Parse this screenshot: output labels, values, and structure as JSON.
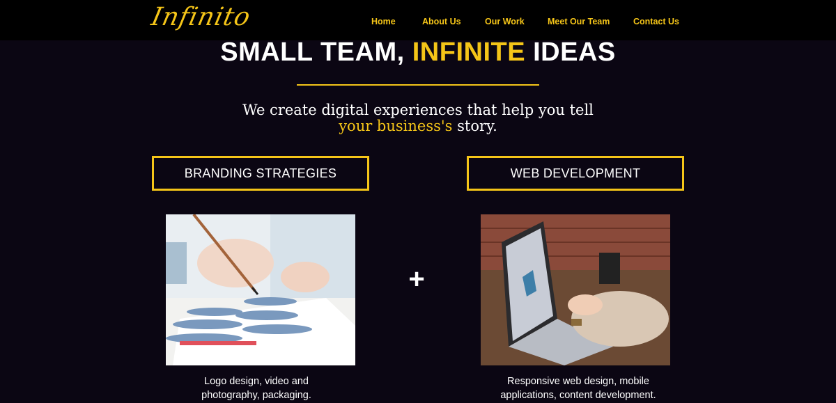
{
  "brand": {
    "logo": "Infinito",
    "accent_color": "#f5c518",
    "background": "#0b0613"
  },
  "nav": {
    "items": [
      {
        "label": "Home"
      },
      {
        "label": "About Us"
      },
      {
        "label": "Our Work"
      },
      {
        "label": "Meet Our Team"
      },
      {
        "label": "Contact Us"
      }
    ]
  },
  "hero": {
    "title_part1": "SMALL TEAM,",
    "title_accent": "INFINITE",
    "title_part2": "IDEAS",
    "tagline_line1": "We create digital experiences that help you tell",
    "tagline_accent": "your business's",
    "tagline_end": "story."
  },
  "services": [
    {
      "title": "BRANDING STRATEGIES",
      "image": "watercolor-painting-photo",
      "desc_line1": "Logo design, video and",
      "desc_line2": "photography, packaging."
    },
    {
      "title": "WEB DEVELOPMENT",
      "image": "laptop-typing-photo",
      "desc_line1": "Responsive web design, mobile",
      "desc_line2": "applications, content development."
    }
  ],
  "plus_symbol": "+"
}
